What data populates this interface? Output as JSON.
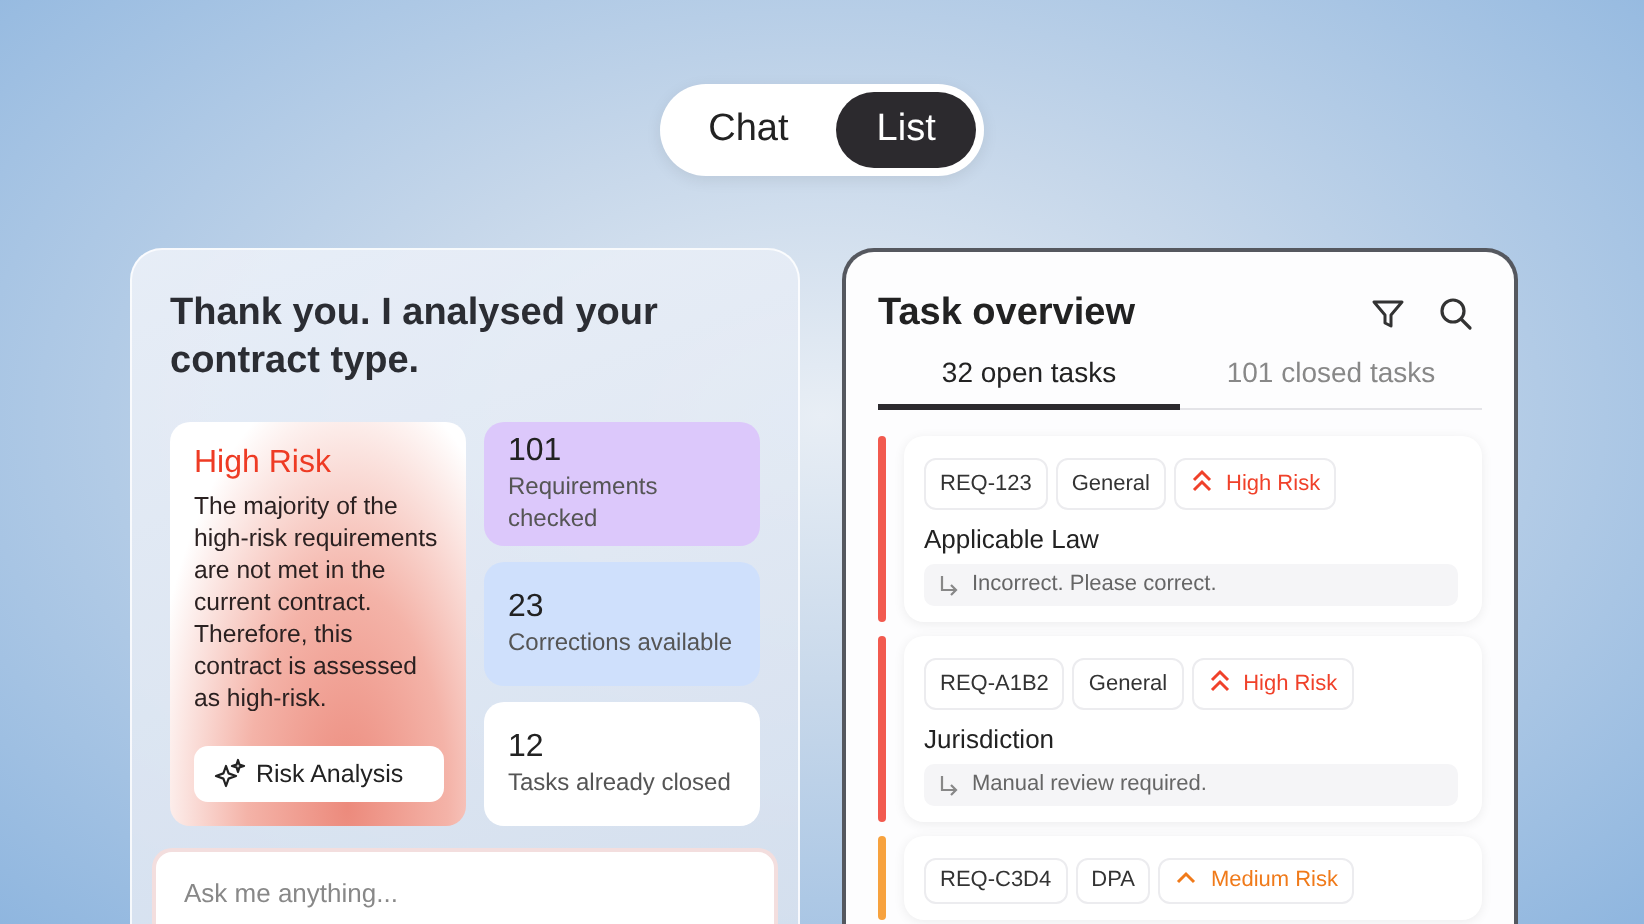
{
  "view_toggle": [
    {
      "label": "Chat",
      "selected": false
    },
    {
      "label": "List",
      "selected": true
    }
  ],
  "chat": {
    "heading": "Thank you. I analysed your contract type.",
    "risk_card": {
      "title": "High Risk",
      "text": "The majority of the high-risk requirements are not met in the current contract. Therefore, this contract is assessed as high-risk.",
      "button": "Risk Analysis"
    },
    "stats": [
      {
        "value": "101",
        "label": "Requirements checked",
        "color": "#dcc8fb"
      },
      {
        "value": "23",
        "label": "Corrections available",
        "color": "#cfe0fc"
      },
      {
        "value": "12",
        "label": "Tasks already closed",
        "color": "#ffffff"
      }
    ],
    "input": {
      "placeholder": "Ask me anything..."
    }
  },
  "tasks": {
    "title": "Task overview",
    "tabs": [
      {
        "label": "32 open tasks",
        "selected": true
      },
      {
        "label": "101 closed tasks",
        "selected": false
      }
    ],
    "items": [
      {
        "id": "REQ-123",
        "category": "General",
        "risk": "High Risk",
        "kind": "high",
        "title": "Applicable Law",
        "note": "Incorrect. Please correct."
      },
      {
        "id": "REQ-A1B2",
        "category": "General",
        "risk": "High Risk",
        "kind": "high",
        "title": "Jurisdiction",
        "note": "Manual review required."
      },
      {
        "id": "REQ-C3D4",
        "category": "DPA",
        "risk": "Medium Risk",
        "kind": "medium"
      }
    ]
  }
}
